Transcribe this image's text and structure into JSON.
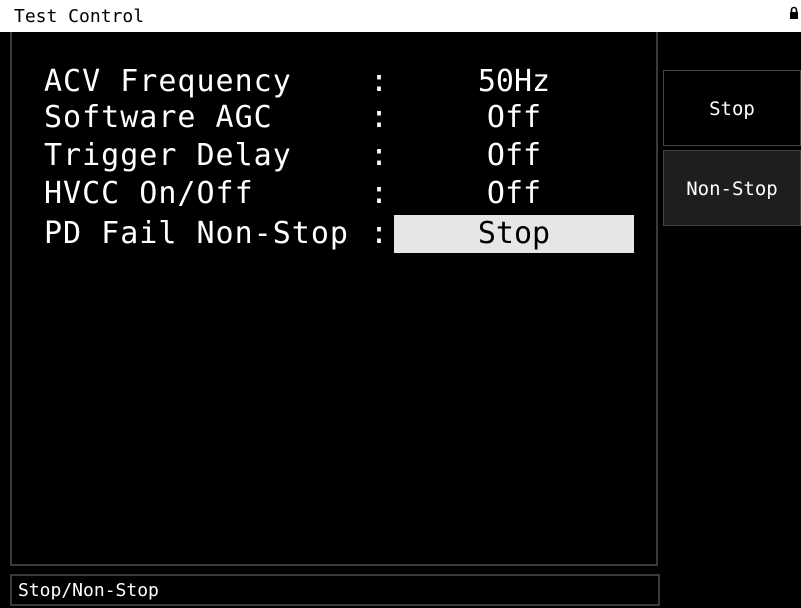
{
  "window": {
    "title": "Test Control",
    "corner_icon": "lock-icon"
  },
  "settings": [
    {
      "label": "ACV Frequency",
      "value": "50Hz",
      "selected": false
    },
    {
      "label": "Software AGC",
      "value": "Off",
      "selected": false
    },
    {
      "label": "Trigger Delay",
      "value": "Off",
      "selected": false
    },
    {
      "label": "HVCC On/Off",
      "value": "Off",
      "selected": false
    },
    {
      "label": "PD Fail Non-Stop",
      "value": "Stop",
      "selected": true
    }
  ],
  "separator": ":",
  "softkeys": [
    {
      "label": "Stop",
      "active": true
    },
    {
      "label": "Non-Stop",
      "active": false
    }
  ],
  "status": {
    "text": "Stop/Non-Stop"
  },
  "colors": {
    "background": "#000000",
    "title_bar": "#ffffff",
    "selected_value_bg": "#e6e6e6",
    "inactive_softkey_bg": "#1e1e1e",
    "border": "#3a3a3a"
  }
}
